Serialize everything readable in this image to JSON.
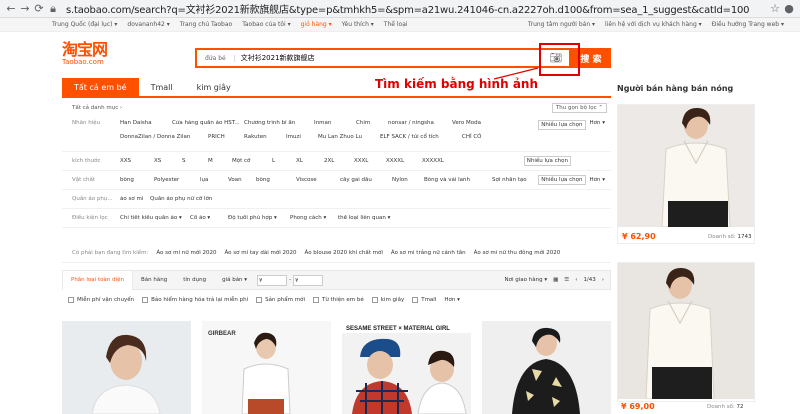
{
  "browser": {
    "url": "s.taobao.com/search?q=文衬衫2021新款旗舰店&type=p&tmhkh5=&spm=a21wu.241046-cn.a2227oh.d100&from=sea_1_suggest&catId=100"
  },
  "topbar": {
    "left": [
      "Trung Quốc (đại lục) ▾",
      "dovananh42 ▾",
      "Trang chủ Taobao",
      "Taobao của tôi ▾",
      "giỏ hàng ▾",
      "Yêu thích ▾",
      "Thể loại"
    ],
    "right": [
      "Trung tâm người bán ▾",
      "liên hệ với dịch vụ khách hàng ▾",
      "Điều hướng Trang web ▾"
    ]
  },
  "logo": {
    "cn": "淘宝网",
    "en": "Taobao.com"
  },
  "search": {
    "tag": "đứa bé",
    "query": "文衬衫2021新款旗舰店",
    "button": "搜 索"
  },
  "annotation": "Tìm kiếm bằng hình ảnh",
  "tabs": [
    "Tất cả em bé",
    "Tmall",
    "kim giây"
  ],
  "filters": {
    "all_categories": "Tất cả danh mục ›",
    "sort_button": "Thu gọn bộ lọc ⌃",
    "rows": [
      {
        "label": "Nhãn hiệu",
        "items": [
          "Han Daisha",
          "Cửa hàng quần áo HST...",
          "Chương trình bí ẩn",
          "Inman",
          "Chim",
          "nonsar / ningsha",
          "Vero Moda",
          "DonnaZilan / Donna Zilan",
          "PRICH",
          "Rakuten",
          "Imuzi",
          "Mu Lan Zhuo Lu",
          "ELF SACK / túi cổ tích",
          "CHÍ CÓ"
        ],
        "more": "Nhiều lựa chọn",
        "hon": "Hơn ▾"
      },
      {
        "label": "kích thước",
        "items": [
          "XXS",
          "XS",
          "S",
          "M",
          "Một cỡ",
          "L",
          "XL",
          "2XL",
          "XXXL",
          "XXXXL",
          "XXXXXL"
        ],
        "more": "Nhiều lựa chọn",
        "hon": ""
      },
      {
        "label": "Vật chất",
        "items": [
          "bông",
          "Polyester",
          "lụa",
          "Voan",
          "bông",
          "Viscose",
          "cây gai dầu",
          "Nylon",
          "Bông và vải lanh",
          "Sợi nhân tạo"
        ],
        "more": "Nhiều lựa chọn",
        "hon": "Hơn ▾"
      },
      {
        "label": "Quần áo phụ...",
        "items": [
          "áo sơ mi",
          "Quần áo phụ nữ cỡ lớn"
        ],
        "more": "",
        "hon": ""
      },
      {
        "label": "Điều kiện lọc",
        "items": [
          "Chi tiết kiểu quần áo ▾",
          "Cổ áo ▾",
          "Độ tuổi phù hợp ▾",
          "Phong cách ▾",
          "thể loại liên quan ▾"
        ],
        "more": "",
        "hon": ""
      }
    ]
  },
  "related": {
    "label": "Có phải bạn đang tìm kiếm:",
    "items": [
      "Áo sơ mi nữ mới 2020",
      "Áo sơ mi tay dài mới 2020",
      "Áo blouse 2020 khí chất mới",
      "Áo sơ mi trắng nữ cánh tân",
      "Áo sơ mi nữ thu đông mới 2020"
    ]
  },
  "sortbar": {
    "sorts": [
      "Phần loại toàn diện",
      "Bán hàng",
      "tín dụng",
      "giá bán ▾"
    ],
    "price_from": "¥",
    "price_to": "¥",
    "location": "Nơi giao hàng ▾",
    "page": "1/43"
  },
  "checks": [
    "Miễn phí vận chuyển",
    "Bảo hiểm hàng hóa trả lại miễn phí",
    "Sản phẩm mới",
    "Từ thiện em bé",
    "kim giây",
    "Tmall",
    "Hơn ▾"
  ],
  "products": [
    {
      "caption": ""
    },
    {
      "caption": "GIRBEAR"
    },
    {
      "caption": "SESAME STREET × MATERIAL GIRL"
    },
    {
      "caption": ""
    }
  ],
  "hot_sellers": {
    "title": "Người bán hàng bán nóng",
    "items": [
      {
        "price": "¥ 62,90",
        "sold_label": "Doanh số:",
        "sold": "1743"
      },
      {
        "price": "¥ 69,00",
        "sold_label": "Doanh số:",
        "sold": "72"
      }
    ]
  },
  "colors": {
    "accent": "#ff5000",
    "annotation": "#e00000"
  }
}
